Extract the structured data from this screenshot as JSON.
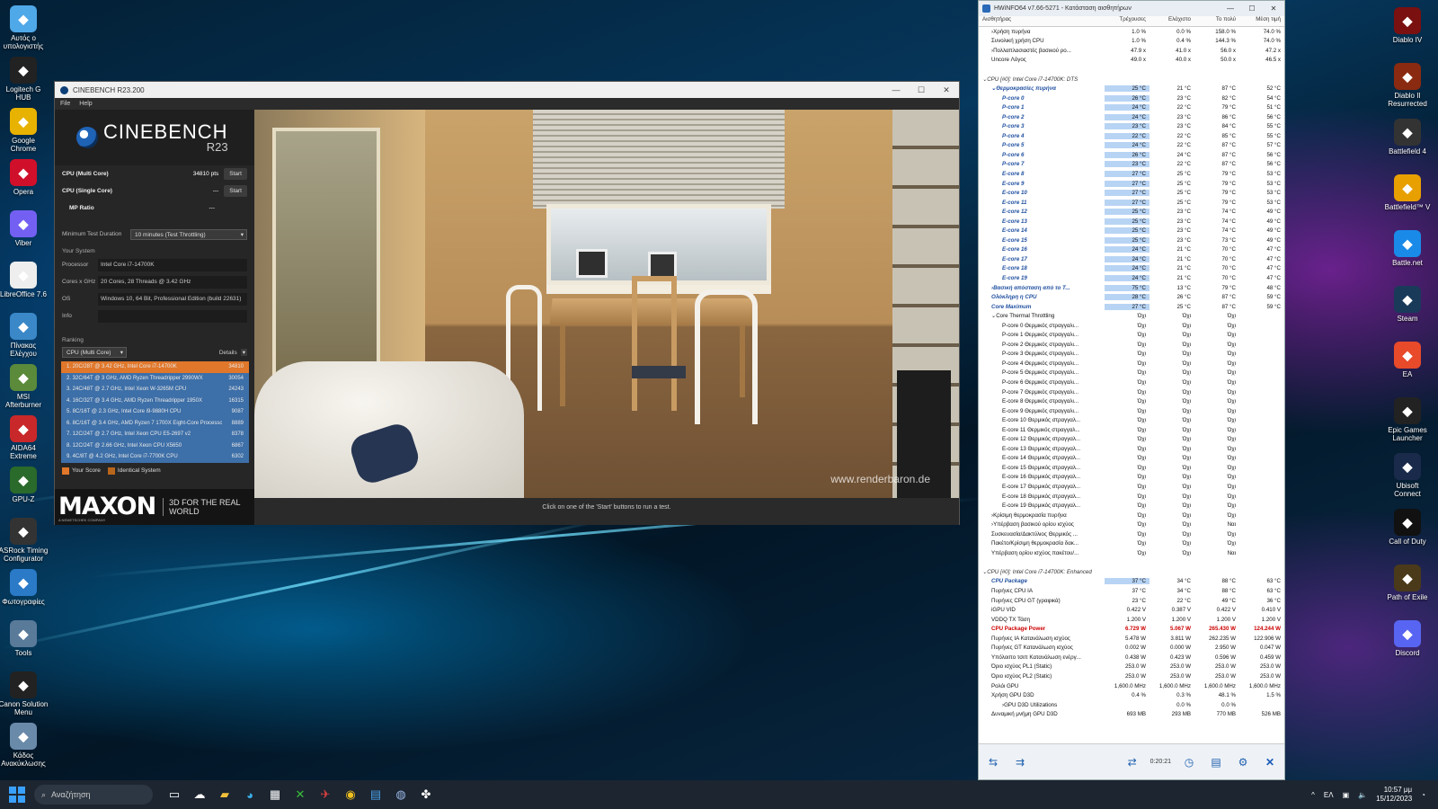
{
  "desktop_left_icons": [
    {
      "label": "Αυτός ο υπολογιστής",
      "icon": "computer-icon",
      "color": "#4fa8e8"
    },
    {
      "label": "Logitech G HUB",
      "icon": "logitech-icon",
      "color": "#222"
    },
    {
      "label": "Google Chrome",
      "icon": "chrome-icon",
      "color": "#e8b200"
    },
    {
      "label": "Opera",
      "icon": "opera-icon",
      "color": "#d0102a"
    },
    {
      "label": "Viber",
      "icon": "viber-icon",
      "color": "#7360f2"
    },
    {
      "label": "LibreOffice 7.6",
      "icon": "libreoffice-icon",
      "color": "#eeeeee"
    },
    {
      "label": "Πίνακας Ελέγχου",
      "icon": "control-panel-icon",
      "color": "#3a88c8"
    },
    {
      "label": "MSI Afterburner",
      "icon": "afterburner-icon",
      "color": "#5a8a3a"
    },
    {
      "label": "AIDA64 Extreme",
      "icon": "aida64-icon",
      "color": "#c8282a"
    },
    {
      "label": "GPU-Z",
      "icon": "gpuz-icon",
      "color": "#2a6a2a"
    },
    {
      "label": "ASRock Timing Configurator",
      "icon": "asrock-icon",
      "color": "#333"
    },
    {
      "label": "Φωτογραφίες",
      "icon": "photos-icon",
      "color": "#2a7ac8"
    },
    {
      "label": "Tools",
      "icon": "folder-icon",
      "color": "#5a7a9a"
    },
    {
      "label": "Canon Solution Menu",
      "icon": "canon-icon",
      "color": "#222"
    },
    {
      "label": "Κάδος Ανακύκλωσης",
      "icon": "recycle-bin-icon",
      "color": "#6a8aaa"
    }
  ],
  "desktop_right_icons": [
    {
      "label": "Diablo IV",
      "icon": "diablo4-icon",
      "color": "#7a1010"
    },
    {
      "label": "Diablo II Resurrected",
      "icon": "diablo2-icon",
      "color": "#8a2a10"
    },
    {
      "label": "Battlefield 4",
      "icon": "bf4-icon",
      "color": "#333"
    },
    {
      "label": "Battlefield™ V",
      "icon": "bfv-icon",
      "color": "#e8a000"
    },
    {
      "label": "Battle.net",
      "icon": "battlenet-icon",
      "color": "#1a8ae8"
    },
    {
      "label": "Steam",
      "icon": "steam-icon",
      "color": "#1a3a5a"
    },
    {
      "label": "EA",
      "icon": "ea-icon",
      "color": "#e84a2a"
    },
    {
      "label": "Epic Games Launcher",
      "icon": "epic-icon",
      "color": "#222"
    },
    {
      "label": "Ubisoft Connect",
      "icon": "ubisoft-icon",
      "color": "#1a2a4a"
    },
    {
      "label": "Call of Duty",
      "icon": "cod-icon",
      "color": "#111"
    },
    {
      "label": "Path of Exile",
      "icon": "poe-icon",
      "color": "#4a3a1a"
    },
    {
      "label": "Discord",
      "icon": "discord-icon",
      "color": "#5865f2"
    }
  ],
  "cinebench": {
    "title": "CINEBENCH R23.200",
    "menu": [
      "File",
      "Help"
    ],
    "logo": "CINEBENCH",
    "logo_sub": "R23",
    "multi_label": "CPU (Multi Core)",
    "multi_value": "34810 pts",
    "start": "Start",
    "single_label": "CPU (Single Core)",
    "single_value": "---",
    "mp_label": "MP Ratio",
    "mp_value": "---",
    "duration_label": "Minimum Test Duration",
    "duration_value": "10 minutes (Test Throttling)",
    "your_system": "Your System",
    "processor_label": "Processor",
    "processor": "Intel Core i7-14700K",
    "cores_label": "Cores x GHz",
    "cores": "20 Cores, 28 Threads @ 3.42 GHz",
    "os_label": "OS",
    "os": "Windows 10, 64 Bit, Professional Edition (build 22631)",
    "info_label": "Info",
    "info": "",
    "ranking": "Ranking",
    "ranking_select": "CPU (Multi Core)",
    "details": "Details",
    "ranks": [
      {
        "t": "1. 20C/28T @ 3.42 GHz, Intel Core i7-14700K",
        "s": "34810",
        "c": "#e0772a"
      },
      {
        "t": "2. 32C/64T @ 3 GHz, AMD Ryzen Threadripper 2990WX",
        "s": "30054",
        "c": "#3d6fa8"
      },
      {
        "t": "3. 24C/48T @ 2.7 GHz, Intel Xeon W-3265M CPU",
        "s": "24243",
        "c": "#3d6fa8"
      },
      {
        "t": "4. 16C/32T @ 3.4 GHz, AMD Ryzen Threadripper 1950X",
        "s": "16315",
        "c": "#3d6fa8"
      },
      {
        "t": "5. 8C/16T @ 2.3 GHz, Intel Core i9-9880H CPU",
        "s": "9087",
        "c": "#3d6fa8"
      },
      {
        "t": "6. 8C/16T @ 3.4 GHz, AMD Ryzen 7 1700X Eight-Core Processor",
        "s": "8889",
        "c": "#3d6fa8"
      },
      {
        "t": "7. 12C/24T @ 2.7 GHz, Intel Xeon CPU E5-2697 v2",
        "s": "8378",
        "c": "#3d6fa8"
      },
      {
        "t": "8. 12C/24T @ 2.66 GHz, Intel Xeon CPU X5650",
        "s": "6867",
        "c": "#3d6fa8"
      },
      {
        "t": "9. 4C/8T @ 4.2 GHz, Intel Core i7-7700K CPU",
        "s": "6302",
        "c": "#3d6fa8"
      }
    ],
    "legend_your": "Your Score",
    "legend_identical": "Identical System",
    "maxon": "MAXON",
    "maxon_sub": "A NEMETSCHEK COMPANY",
    "tagline": "3D FOR THE REAL WORLD",
    "watermark": "www.renderbaron.de",
    "status": "Click on one of the 'Start' buttons to run a test."
  },
  "hwinfo": {
    "title": "HWiNFO64 v7.66-5271 - Κατάσταση αισθητήρων",
    "headers": [
      "Αισθητήρας",
      "Τρέχουσες",
      "Ελάχιστο",
      "Το πολύ",
      "Μέση τιμή"
    ],
    "rows": [
      {
        "n": "Χρήση πυρήνα",
        "v": [
          "1.0 %",
          "0.0 %",
          "158.0 %",
          "74.0 %"
        ],
        "i": 1,
        "x": ">"
      },
      {
        "n": "Συνολική χρήση CPU",
        "v": [
          "1.0 %",
          "0.4 %",
          "144.3 %",
          "74.0 %"
        ],
        "i": 1
      },
      {
        "n": "Πολλαπλασιαστές βασικού ρο...",
        "v": [
          "47.9 x",
          "41.0 x",
          "56.0 x",
          "47.2 x"
        ],
        "i": 1,
        "x": ">"
      },
      {
        "n": "Uncore Λόγος",
        "v": [
          "49.0 x",
          "40.0 x",
          "50.0 x",
          "46.5 x"
        ],
        "i": 1
      },
      {
        "n": "",
        "v": [
          "",
          "",
          "",
          ""
        ],
        "i": 0
      },
      {
        "n": "CPU [#0]: Intel Core i7-14700K: DTS",
        "v": [
          "",
          "",
          "",
          ""
        ],
        "i": 0,
        "g": 1,
        "x": "v"
      },
      {
        "n": "Θερμοκρασίες πυρήνα",
        "v": [
          "25 °C",
          "21 °C",
          "87 °C",
          "52 °C"
        ],
        "i": 1,
        "b": 1,
        "x": "v"
      },
      {
        "n": "P-core 0",
        "v": [
          "26 °C",
          "23 °C",
          "82 °C",
          "54 °C"
        ],
        "i": 2,
        "b": 1
      },
      {
        "n": "P-core 1",
        "v": [
          "24 °C",
          "22 °C",
          "79 °C",
          "51 °C"
        ],
        "i": 2,
        "b": 1
      },
      {
        "n": "P-core 2",
        "v": [
          "24 °C",
          "23 °C",
          "86 °C",
          "56 °C"
        ],
        "i": 2,
        "b": 1
      },
      {
        "n": "P-core 3",
        "v": [
          "23 °C",
          "23 °C",
          "84 °C",
          "55 °C"
        ],
        "i": 2,
        "b": 1
      },
      {
        "n": "P-core 4",
        "v": [
          "22 °C",
          "22 °C",
          "85 °C",
          "55 °C"
        ],
        "i": 2,
        "b": 1
      },
      {
        "n": "P-core 5",
        "v": [
          "24 °C",
          "22 °C",
          "87 °C",
          "57 °C"
        ],
        "i": 2,
        "b": 1
      },
      {
        "n": "P-core 6",
        "v": [
          "26 °C",
          "24 °C",
          "87 °C",
          "56 °C"
        ],
        "i": 2,
        "b": 1
      },
      {
        "n": "P-core 7",
        "v": [
          "23 °C",
          "22 °C",
          "87 °C",
          "56 °C"
        ],
        "i": 2,
        "b": 1
      },
      {
        "n": "E-core 8",
        "v": [
          "27 °C",
          "25 °C",
          "79 °C",
          "53 °C"
        ],
        "i": 2,
        "b": 1
      },
      {
        "n": "E-core 9",
        "v": [
          "27 °C",
          "25 °C",
          "79 °C",
          "53 °C"
        ],
        "i": 2,
        "b": 1
      },
      {
        "n": "E-core 10",
        "v": [
          "27 °C",
          "25 °C",
          "79 °C",
          "53 °C"
        ],
        "i": 2,
        "b": 1
      },
      {
        "n": "E-core 11",
        "v": [
          "27 °C",
          "25 °C",
          "79 °C",
          "53 °C"
        ],
        "i": 2,
        "b": 1
      },
      {
        "n": "E-core 12",
        "v": [
          "25 °C",
          "23 °C",
          "74 °C",
          "49 °C"
        ],
        "i": 2,
        "b": 1
      },
      {
        "n": "E-core 13",
        "v": [
          "25 °C",
          "23 °C",
          "74 °C",
          "49 °C"
        ],
        "i": 2,
        "b": 1
      },
      {
        "n": "E-core 14",
        "v": [
          "25 °C",
          "23 °C",
          "74 °C",
          "49 °C"
        ],
        "i": 2,
        "b": 1
      },
      {
        "n": "E-core 15",
        "v": [
          "25 °C",
          "23 °C",
          "73 °C",
          "49 °C"
        ],
        "i": 2,
        "b": 1
      },
      {
        "n": "E-core 16",
        "v": [
          "24 °C",
          "21 °C",
          "70 °C",
          "47 °C"
        ],
        "i": 2,
        "b": 1
      },
      {
        "n": "E-core 17",
        "v": [
          "24 °C",
          "21 °C",
          "70 °C",
          "47 °C"
        ],
        "i": 2,
        "b": 1
      },
      {
        "n": "E-core 18",
        "v": [
          "24 °C",
          "21 °C",
          "70 °C",
          "47 °C"
        ],
        "i": 2,
        "b": 1
      },
      {
        "n": "E-core 19",
        "v": [
          "24 °C",
          "21 °C",
          "70 °C",
          "47 °C"
        ],
        "i": 2,
        "b": 1
      },
      {
        "n": "Βασική απόσταση από το T...",
        "v": [
          "75 °C",
          "13 °C",
          "79 °C",
          "48 °C"
        ],
        "i": 1,
        "b": 1,
        "x": ">"
      },
      {
        "n": "Ολόκληρη η CPU",
        "v": [
          "28 °C",
          "26 °C",
          "87 °C",
          "59 °C"
        ],
        "i": 1,
        "b": 1
      },
      {
        "n": "Core Maximum",
        "v": [
          "27 °C",
          "25 °C",
          "87 °C",
          "59 °C"
        ],
        "i": 1,
        "b": 1
      },
      {
        "n": "Core Thermal Throttling",
        "v": [
          "Όχι",
          "Όχι",
          "Όχι",
          ""
        ],
        "i": 1,
        "x": "v"
      },
      {
        "n": "P-core 0 Θερμικός στραγγαλι...",
        "v": [
          "Όχι",
          "Όχι",
          "Όχι",
          ""
        ],
        "i": 2
      },
      {
        "n": "P-core 1 Θερμικός στραγγαλι...",
        "v": [
          "Όχι",
          "Όχι",
          "Όχι",
          ""
        ],
        "i": 2
      },
      {
        "n": "P-core 2 Θερμικός στραγγαλι...",
        "v": [
          "Όχι",
          "Όχι",
          "Όχι",
          ""
        ],
        "i": 2
      },
      {
        "n": "P-core 3 Θερμικός στραγγαλι...",
        "v": [
          "Όχι",
          "Όχι",
          "Όχι",
          ""
        ],
        "i": 2
      },
      {
        "n": "P-core 4 Θερμικός στραγγαλι...",
        "v": [
          "Όχι",
          "Όχι",
          "Όχι",
          ""
        ],
        "i": 2
      },
      {
        "n": "P-core 5 Θερμικός στραγγαλι...",
        "v": [
          "Όχι",
          "Όχι",
          "Όχι",
          ""
        ],
        "i": 2
      },
      {
        "n": "P-core 6 Θερμικός στραγγαλι...",
        "v": [
          "Όχι",
          "Όχι",
          "Όχι",
          ""
        ],
        "i": 2
      },
      {
        "n": "P-core 7 Θερμικός στραγγαλι...",
        "v": [
          "Όχι",
          "Όχι",
          "Όχι",
          ""
        ],
        "i": 2
      },
      {
        "n": "E-core 8 Θερμικός στραγγαλι...",
        "v": [
          "Όχι",
          "Όχι",
          "Όχι",
          ""
        ],
        "i": 2
      },
      {
        "n": "E-core 9 Θερμικός στραγγαλι...",
        "v": [
          "Όχι",
          "Όχι",
          "Όχι",
          ""
        ],
        "i": 2
      },
      {
        "n": "E-core 10 Θερμικός στραγγαλ...",
        "v": [
          "Όχι",
          "Όχι",
          "Όχι",
          ""
        ],
        "i": 2
      },
      {
        "n": "E-core 11 Θερμικός στραγγαλ...",
        "v": [
          "Όχι",
          "Όχι",
          "Όχι",
          ""
        ],
        "i": 2
      },
      {
        "n": "E-core 12 Θερμικός στραγγαλ...",
        "v": [
          "Όχι",
          "Όχι",
          "Όχι",
          ""
        ],
        "i": 2
      },
      {
        "n": "E-core 13 Θερμικός στραγγαλ...",
        "v": [
          "Όχι",
          "Όχι",
          "Όχι",
          ""
        ],
        "i": 2
      },
      {
        "n": "E-core 14 Θερμικός στραγγαλ...",
        "v": [
          "Όχι",
          "Όχι",
          "Όχι",
          ""
        ],
        "i": 2
      },
      {
        "n": "E-core 15 Θερμικός στραγγαλ...",
        "v": [
          "Όχι",
          "Όχι",
          "Όχι",
          ""
        ],
        "i": 2
      },
      {
        "n": "E-core 16 Θερμικός στραγγαλ...",
        "v": [
          "Όχι",
          "Όχι",
          "Όχι",
          ""
        ],
        "i": 2
      },
      {
        "n": "E-core 17 Θερμικός στραγγαλ...",
        "v": [
          "Όχι",
          "Όχι",
          "Όχι",
          ""
        ],
        "i": 2
      },
      {
        "n": "E-core 18 Θερμικός στραγγαλ...",
        "v": [
          "Όχι",
          "Όχι",
          "Όχι",
          ""
        ],
        "i": 2
      },
      {
        "n": "E-core 19 Θερμικός στραγγαλ...",
        "v": [
          "Όχι",
          "Όχι",
          "Όχι",
          ""
        ],
        "i": 2
      },
      {
        "n": "Κρίσιμη θερμοκρασία πυρήνα",
        "v": [
          "Όχι",
          "Όχι",
          "Όχι",
          ""
        ],
        "i": 1,
        "x": ">"
      },
      {
        "n": "Υπέρβαση βασικού ορίου ισχύος",
        "v": [
          "Όχι",
          "Όχι",
          "Ναι",
          ""
        ],
        "i": 1,
        "x": ">"
      },
      {
        "n": "Συσκευασία/Δακτύλιος Θερμικός ...",
        "v": [
          "Όχι",
          "Όχι",
          "Όχι",
          ""
        ],
        "i": 1
      },
      {
        "n": "Πακέτο/Κρίσιμη θερμοκρασία δακ...",
        "v": [
          "Όχι",
          "Όχι",
          "Όχι",
          ""
        ],
        "i": 1
      },
      {
        "n": "Υπέρβαση ορίου ισχύος πακέτου/...",
        "v": [
          "Όχι",
          "Όχι",
          "Ναι",
          ""
        ],
        "i": 1
      },
      {
        "n": "",
        "v": [
          "",
          "",
          "",
          ""
        ],
        "i": 0
      },
      {
        "n": "CPU [#0]: Intel Core i7-14700K: Enhanced",
        "v": [
          "",
          "",
          "",
          ""
        ],
        "i": 0,
        "g": 1,
        "x": "v"
      },
      {
        "n": "CPU Package",
        "v": [
          "37 °C",
          "34 °C",
          "88 °C",
          "63 °C"
        ],
        "i": 1,
        "b": 1
      },
      {
        "n": "Πυρήνες CPU IA",
        "v": [
          "37 °C",
          "34 °C",
          "88 °C",
          "63 °C"
        ],
        "i": 1
      },
      {
        "n": "Πυρήνες CPU GT (γραφικά)",
        "v": [
          "23 °C",
          "22 °C",
          "49 °C",
          "36 °C"
        ],
        "i": 1
      },
      {
        "n": "iGPU VID",
        "v": [
          "0.422 V",
          "0.387 V",
          "0.422 V",
          "0.410 V"
        ],
        "i": 1
      },
      {
        "n": "VDDQ TX Τάση",
        "v": [
          "1.200 V",
          "1.200 V",
          "1.200 V",
          "1.200 V"
        ],
        "i": 1
      },
      {
        "n": "CPU Package Power",
        "v": [
          "6.729 W",
          "5.067 W",
          "265.430 W",
          "124.244 W"
        ],
        "i": 1,
        "r": 1
      },
      {
        "n": "Πυρήνες IA Κατανάλωση ισχύος",
        "v": [
          "5.478 W",
          "3.811 W",
          "262.235 W",
          "122.906 W"
        ],
        "i": 1
      },
      {
        "n": "Πυρήνες GT Κατανάλωση ισχύος",
        "v": [
          "0.002 W",
          "0.000 W",
          "2.950 W",
          "0.047 W"
        ],
        "i": 1
      },
      {
        "n": "Υπόλοιπο τσιπ Κατανάλωση ενέργ...",
        "v": [
          "0.438 W",
          "0.423 W",
          "0.596 W",
          "0.459 W"
        ],
        "i": 1
      },
      {
        "n": "Όριο ισχύος PL1 (Static)",
        "v": [
          "253.0 W",
          "253.0 W",
          "253.0 W",
          "253.0 W"
        ],
        "i": 1
      },
      {
        "n": "Όριο ισχύος PL2 (Static)",
        "v": [
          "253.0 W",
          "253.0 W",
          "253.0 W",
          "253.0 W"
        ],
        "i": 1
      },
      {
        "n": "Ρολόι GPU",
        "v": [
          "1,600.0 MHz",
          "1,600.0 MHz",
          "1,600.0 MHz",
          "1,600.0 MHz"
        ],
        "i": 1
      },
      {
        "n": "Χρήση GPU D3D",
        "v": [
          "0.4 %",
          "0.3 %",
          "48.1 %",
          "1.5 %"
        ],
        "i": 1
      },
      {
        "n": "GPU D3D Utilizations",
        "v": [
          "",
          "0.0 %",
          "0.0 %",
          ""
        ],
        "i": 2,
        "x": ">"
      },
      {
        "n": "Δυναμική μνήμη GPU D3D",
        "v": [
          "693 MB",
          "293 MB",
          "770 MB",
          "526 MB"
        ],
        "i": 1
      }
    ],
    "timer": "0:20:21"
  },
  "taskbar": {
    "search_placeholder": "Αναζήτηση",
    "lang": "ΕΛ",
    "time": "10:57 μμ",
    "date": "15/12/2023"
  }
}
